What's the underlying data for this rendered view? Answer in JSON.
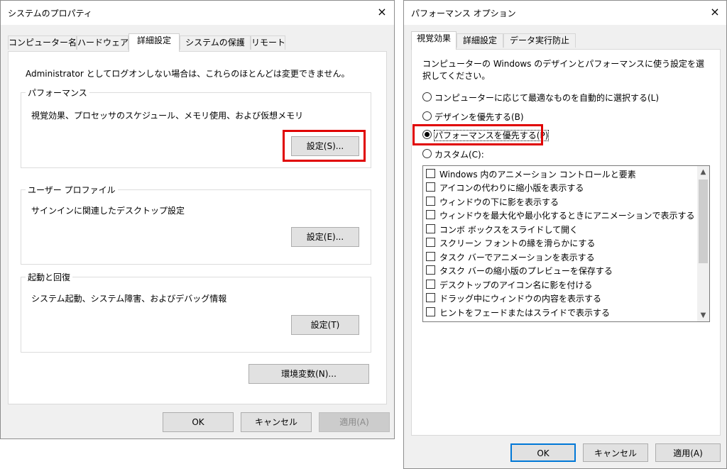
{
  "left_dialog": {
    "title": "システムのプロパティ",
    "close_icon": "×",
    "tabs": [
      "コンピューター名",
      "ハードウェア",
      "詳細設定",
      "システムの保護",
      "リモート"
    ],
    "active_tab": "詳細設定",
    "admin_notice": "Administrator としてログオンしない場合は、これらのほとんどは変更できません。",
    "performance": {
      "title": "パフォーマンス",
      "description": "視覚効果、プロセッサのスケジュール、メモリ使用、および仮想メモリ",
      "button": "設定(S)..."
    },
    "user_profile": {
      "title": "ユーザー プロファイル",
      "description": "サインインに関連したデスクトップ設定",
      "button": "設定(E)..."
    },
    "startup": {
      "title": "起動と回復",
      "description": "システム起動、システム障害、およびデバッグ情報",
      "button": "設定(T)"
    },
    "env_button": "環境変数(N)...",
    "ok": "OK",
    "cancel": "キャンセル",
    "apply": "適用(A)"
  },
  "right_dialog": {
    "title": "パフォーマンス オプション",
    "close_icon": "×",
    "tabs": [
      "視覚効果",
      "詳細設定",
      "データ実行防止"
    ],
    "active_tab": "視覚効果",
    "description": "コンピューターの Windows のデザインとパフォーマンスに使う設定を選択してください。",
    "radios": [
      {
        "label": "コンピューターに応じて最適なものを自動的に選択する(L)",
        "selected": false
      },
      {
        "label": "デザインを優先する(B)",
        "selected": false
      },
      {
        "label": "パフォーマンスを優先する(P)",
        "selected": true
      },
      {
        "label": "カスタム(C):",
        "selected": false
      }
    ],
    "options": [
      "Windows 内のアニメーション コントロールと要素",
      "アイコンの代わりに縮小版を表示する",
      "ウィンドウの下に影を表示する",
      "ウィンドウを最大化や最小化するときにアニメーションで表示する",
      "コンボ ボックスをスライドして開く",
      "スクリーン フォントの縁を滑らかにする",
      "タスク バーでアニメーションを表示する",
      "タスク バーの縮小版のプレビューを保存する",
      "デスクトップのアイコン名に影を付ける",
      "ドラッグ中にウィンドウの内容を表示する",
      "ヒントをフェードまたはスライドで表示する"
    ],
    "ok": "OK",
    "cancel": "キャンセル",
    "apply": "適用(A)"
  },
  "highlight_color": "#e00000"
}
